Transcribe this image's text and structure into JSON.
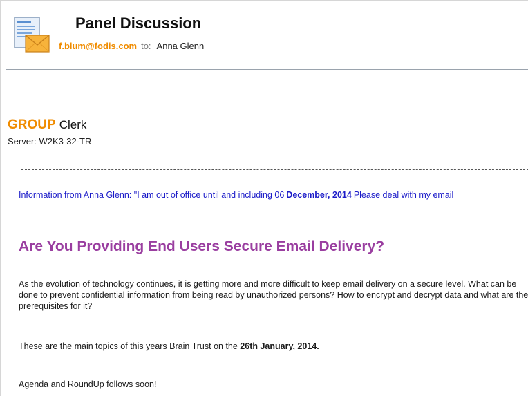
{
  "header": {
    "subject": "Panel Discussion",
    "from_address": "f.blum@fodis.com",
    "to_label": "to:",
    "to_name": "Anna Glenn",
    "icon": "email-envelope-icon"
  },
  "signature": {
    "group_word": "GROUP",
    "clerk_word": "Clerk",
    "server_line": "Server: W2K3-32-TR"
  },
  "out_of_office": {
    "prefix": "Information from Anna Glenn: \"I am out of office until and including 06",
    "date": "December, 2014",
    "suffix": "Please deal with my email"
  },
  "body": {
    "headline": "Are You Providing End Users Secure Email Delivery?",
    "paragraph1": "As the evolution of technology continues, it is getting more and more difficult to keep email delivery on a secure level. What can be done to prevent confidential information from being read by unauthorized persons? How to encrypt and decrypt data and what are the prerequisites for it?",
    "paragraph2_prefix": "These are the main topics of this years Brain Trust on the ",
    "paragraph2_date": "26th January, 2014.",
    "paragraph3": "Agenda and RoundUp follows soon!"
  },
  "colors": {
    "accent_orange": "#f08c00",
    "headline_purple": "#9a3ea0",
    "ooo_blue": "#1a1ac8"
  }
}
